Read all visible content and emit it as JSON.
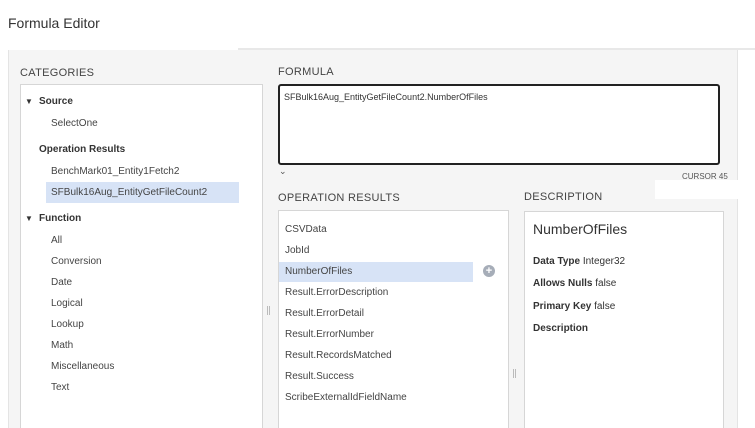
{
  "window": {
    "title": "Formula Editor"
  },
  "categories": {
    "header": "CATEGORIES",
    "groups": [
      {
        "label": "Source",
        "items": [
          "SelectOne"
        ]
      },
      {
        "label": "Operation Results",
        "items": [
          "BenchMark01_Entity1Fetch2",
          "SFBulk16Aug_EntityGetFileCount2"
        ],
        "selected": "SFBulk16Aug_EntityGetFileCount2"
      },
      {
        "label": "Function",
        "items": [
          "All",
          "Conversion",
          "Date",
          "Logical",
          "Lookup",
          "Math",
          "Miscellaneous",
          "Text"
        ]
      }
    ]
  },
  "formula": {
    "header": "FORMULA",
    "value": "SFBulk16Aug_EntityGetFileCount2.NumberOfFiles",
    "cursor_label": "CURSOR 45"
  },
  "operation_results": {
    "header": "OPERATION RESULTS",
    "items": [
      "CSVData",
      "JobId",
      "NumberOfFiles",
      "Result.ErrorDescription",
      "Result.ErrorDetail",
      "Result.ErrorNumber",
      "Result.RecordsMatched",
      "Result.Success",
      "ScribeExternalIdFieldName"
    ],
    "selected": "NumberOfFiles",
    "add_icon": "plus-circle-icon"
  },
  "description": {
    "header": "DESCRIPTION",
    "name": "NumberOfFiles",
    "data_type_label": "Data Type",
    "data_type_value": "Integer32",
    "allows_nulls_label": "Allows Nulls",
    "allows_nulls_value": "false",
    "primary_key_label": "Primary Key",
    "primary_key_value": "false",
    "description_label": "Description"
  },
  "colors": {
    "selection": "#d7e3f6",
    "panel_border": "#d6d6d6",
    "workspace": "#f5f5f5"
  }
}
